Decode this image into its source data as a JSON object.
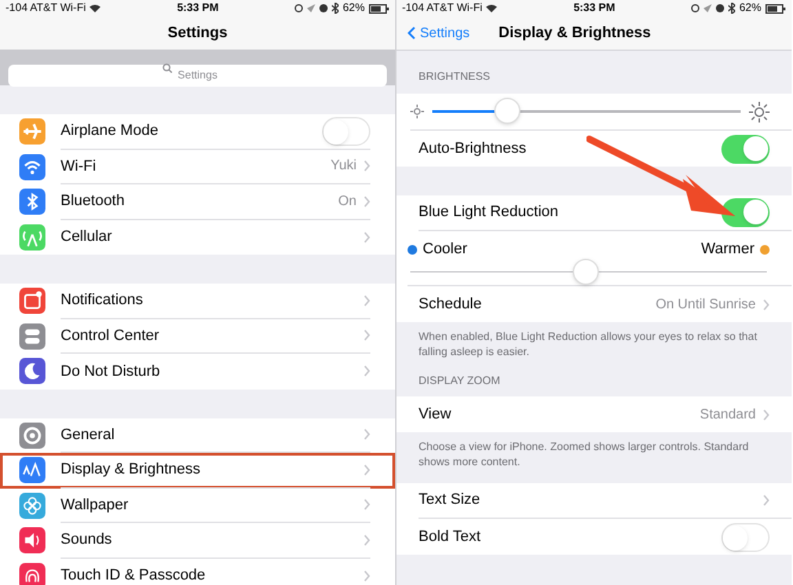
{
  "settings_screen": {
    "status_bar": {
      "carrier": "-104 AT&T Wi-Fi",
      "time": "5:33 PM",
      "battery": "62%"
    },
    "title": "Settings",
    "search": {
      "placeholder": "Settings"
    },
    "groups": [
      [
        {
          "label": "Airplane Mode",
          "kind": "toggle",
          "on": false
        },
        {
          "label": "Wi-Fi",
          "kind": "link",
          "value": "Yuki"
        },
        {
          "label": "Bluetooth",
          "kind": "link",
          "value": "On"
        },
        {
          "label": "Cellular",
          "kind": "link"
        }
      ],
      [
        {
          "label": "Notifications",
          "kind": "link"
        },
        {
          "label": "Control Center",
          "kind": "link"
        },
        {
          "label": "Do Not Disturb",
          "kind": "link"
        }
      ],
      [
        {
          "label": "General",
          "kind": "link",
          "highlighted": false
        },
        {
          "label": "Display & Brightness",
          "kind": "link",
          "highlighted": true
        },
        {
          "label": "Wallpaper",
          "kind": "link",
          "highlighted": false
        },
        {
          "label": "Sounds",
          "kind": "link",
          "highlighted": false
        },
        {
          "label": "Touch ID & Passcode",
          "kind": "link",
          "highlighted": false
        }
      ]
    ]
  },
  "display_screen": {
    "status_bar": {
      "carrier": "-104 AT&T Wi-Fi",
      "time": "5:33 PM",
      "battery": "62%"
    },
    "back": "Settings",
    "title": "Display & Brightness",
    "sections": [
      {
        "header": "BRIGHTNESS",
        "rows": [
          {
            "kind": "slider",
            "level": 0.24
          },
          {
            "kind": "toggle",
            "label": "Auto-Brightness",
            "on": true
          }
        ]
      },
      {
        "rows": [
          {
            "kind": "toggle",
            "label": "Blue Light Reduction",
            "on": true
          },
          {
            "kind": "tint",
            "left_label": "Cooler",
            "right_label": "Warmer",
            "level": 0.49
          },
          {
            "kind": "link",
            "label": "Schedule",
            "value": "On Until Sunrise"
          }
        ],
        "footer": "When enabled, Blue Light Reduction allows your eyes to relax so that falling asleep is easier."
      },
      {
        "header": "DISPLAY ZOOM",
        "rows": [
          {
            "kind": "link",
            "label": "View",
            "value": "Standard"
          }
        ],
        "footer": "Choose a view for iPhone. Zoomed shows larger controls. Standard shows more content."
      },
      {
        "rows": [
          {
            "kind": "link",
            "label": "Text Size"
          },
          {
            "kind": "toggle",
            "label": "Bold Text",
            "on": false
          }
        ]
      }
    ]
  }
}
